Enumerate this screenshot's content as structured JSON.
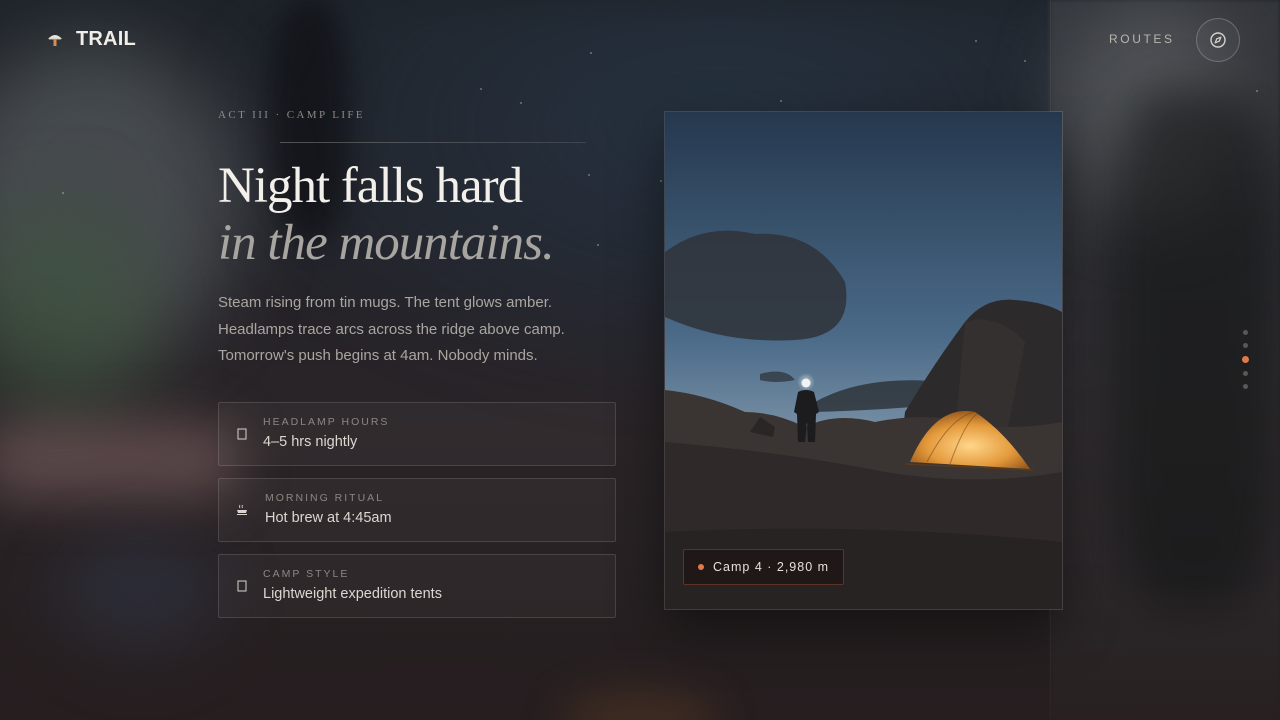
{
  "brand": {
    "name": "TRAIL",
    "logo_icon": "mushroom-logo-icon"
  },
  "nav": {
    "routes_label": "ROUTES",
    "compass_icon": "compass-icon"
  },
  "hero": {
    "eyebrow": "ACT III · CAMP LIFE",
    "title_line1": "Night falls hard",
    "title_line2": "in the mountains.",
    "lede": [
      "Steam rising from tin mugs. The tent glows amber.",
      "Headlamps trace arcs across the ridge above camp.",
      "Tomorrow's push begins at 4am. Nobody minds."
    ]
  },
  "cards": [
    {
      "icon": "headlamp-icon",
      "label": "HEADLAMP HOURS",
      "value": "4–5 hrs nightly"
    },
    {
      "icon": "coffee-cup-icon",
      "label": "MORNING RITUAL",
      "value": "Hot brew at 4:45am"
    },
    {
      "icon": "tent-icon",
      "label": "CAMP STYLE",
      "value": "Lightweight expedition tents"
    }
  ],
  "photo": {
    "caption": "Camp 4 · 2,980 m"
  },
  "pager": {
    "count": 5,
    "active_index": 2
  },
  "colors": {
    "accent": "#e07a4b",
    "background": "#1d1b1d",
    "text": "#f3efea"
  }
}
